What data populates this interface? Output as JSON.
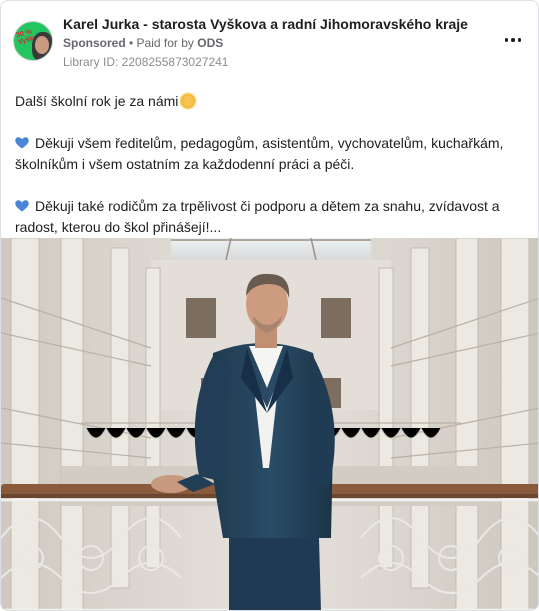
{
  "post": {
    "author": "Karel Jurka - starosta Vyškova a radní Jihomoravského kraje",
    "sponsored_label": "Sponsored",
    "separator": " • ",
    "paid_for_prefix": "Paid for by ",
    "paid_for_by": "ODS",
    "library_id": "Library ID: 2208255873027241",
    "avatar_badge": "30 % Vyškov",
    "more_icon": "more-horizontal-icon",
    "paragraphs": [
      {
        "icon": "sun-emoji",
        "text": "Další školní rok je za námi"
      },
      {
        "icon": "blue-heart-emoji",
        "text": "Děkuji všem ředitelům, pedagogům, asistentům, vychovatelům, kuchařkám, školníkům i všem ostatním za každodenní práci a péči."
      },
      {
        "icon": "blue-heart-emoji",
        "text": "Děkuji také rodičům za trpělivost či podporu a dětem za snahu, zvídavost a radost, kterou do škol přinášejí!..."
      }
    ],
    "photo_subject": "man in navy suit leaning on balustrade in atrium",
    "colors": {
      "heart": "#4a86d6",
      "avatar_bg": "#22c55e"
    }
  }
}
